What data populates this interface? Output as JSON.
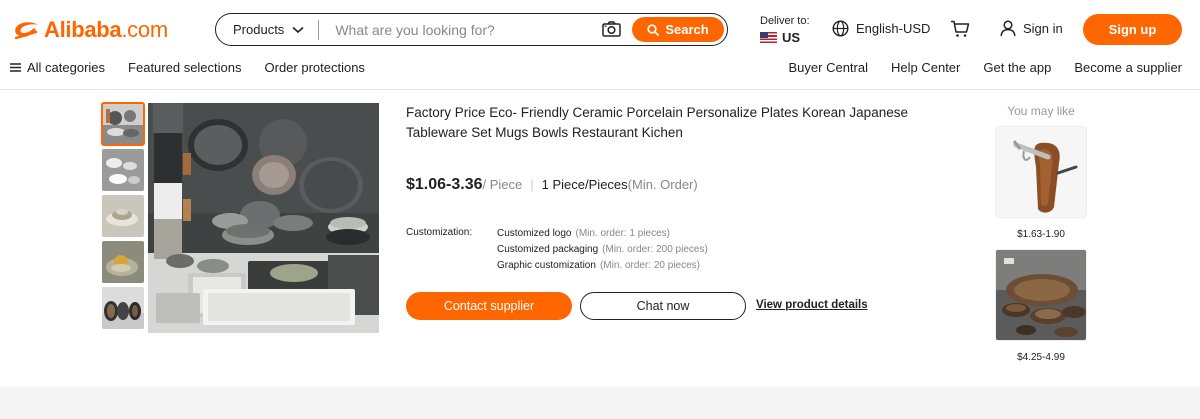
{
  "header": {
    "logo_text": "Alibaba",
    "logo_suffix": ".com",
    "brand_color": "#ff6600",
    "search": {
      "category": "Products",
      "placeholder": "What are you looking for?",
      "button_label": "Search",
      "camera_icon": "camera-icon",
      "search_icon": "search-icon"
    },
    "deliver": {
      "label": "Deliver to:",
      "country": "US"
    },
    "language": "English-USD",
    "signin": "Sign in",
    "signup": "Sign up"
  },
  "nav": {
    "left": [
      "All categories",
      "Featured selections",
      "Order protections"
    ],
    "right": [
      "Buyer Central",
      "Help Center",
      "Get the app",
      "Become a supplier"
    ]
  },
  "product": {
    "title": "Factory Price Eco- Friendly Ceramic Porcelain Personalize Plates Korean Japanese Tableware Set Mugs Bowls Restaurant Kichen",
    "price": "$1.06-3.36",
    "unit": "/ Piece",
    "moq": "1 Piece/Pieces",
    "moq_note": "(Min. Order)",
    "customization": {
      "label": "Customization:",
      "options": [
        {
          "name": "Customized logo",
          "note": "(Min. order: 1 pieces)"
        },
        {
          "name": "Customized packaging",
          "note": "(Min. order: 200 pieces)"
        },
        {
          "name": "Graphic customization",
          "note": "(Min. order: 20 pieces)"
        }
      ]
    },
    "contact_label": "Contact supplier",
    "chat_label": "Chat now",
    "view_details": "View product details",
    "thumbnail_count": 5,
    "active_thumbnail": 1
  },
  "recommend": {
    "title": "You may like",
    "items": [
      {
        "price": "$1.63-1.90"
      },
      {
        "price": "$4.25-4.99"
      }
    ]
  }
}
